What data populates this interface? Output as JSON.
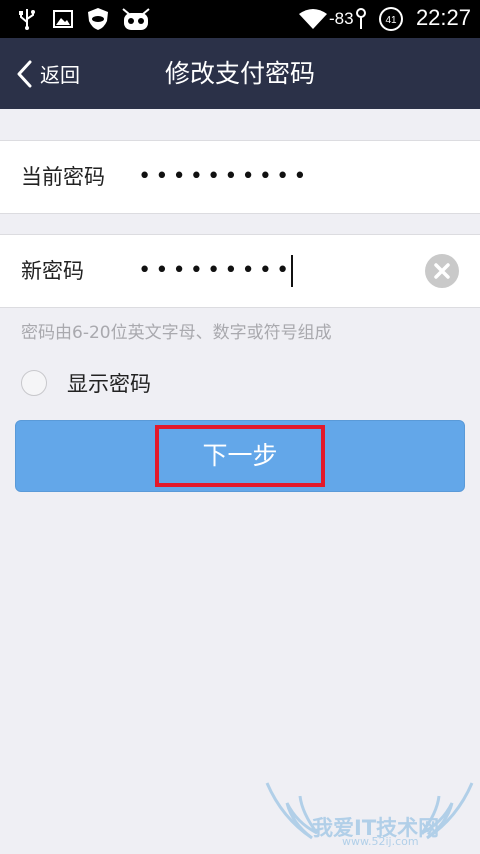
{
  "status_bar": {
    "signal_text": "-83",
    "notification_badge": "41",
    "time": "22:27",
    "icons": [
      "usb-icon",
      "image-icon",
      "shield-icon",
      "android-icon",
      "wifi-icon",
      "signal-icon",
      "badge-icon"
    ]
  },
  "nav": {
    "back_label": "返回",
    "title": "修改支付密码"
  },
  "form": {
    "current_password": {
      "label": "当前密码",
      "value": "••••••••••"
    },
    "new_password": {
      "label": "新密码",
      "value": "•••••••••"
    },
    "hint": "密码由6-20位英文字母、数字或符号组成",
    "show_password_label": "显示密码",
    "show_password_checked": false
  },
  "next_button": {
    "label": "下一步"
  },
  "watermark": {
    "text": "我爱IT技术网",
    "url": "www.52ij.com"
  },
  "colors": {
    "nav_background": "#2b3148",
    "button_background": "#63a7e9",
    "highlight_border": "#e3192b",
    "page_background": "#efeff4"
  }
}
